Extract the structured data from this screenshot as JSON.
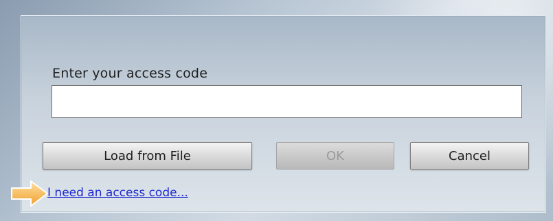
{
  "dialog": {
    "prompt_label": "Enter your access code",
    "access_code_value": "",
    "buttons": {
      "load_from_file": "Load from File",
      "ok": "OK",
      "cancel": "Cancel"
    },
    "access_link": "I need an access code..."
  },
  "icons": {
    "pointer": "arrow-right-icon"
  },
  "colors": {
    "link": "#1f2ad0",
    "arrow_fill": "#f5b54a",
    "disabled_text": "#9a9a9a"
  }
}
